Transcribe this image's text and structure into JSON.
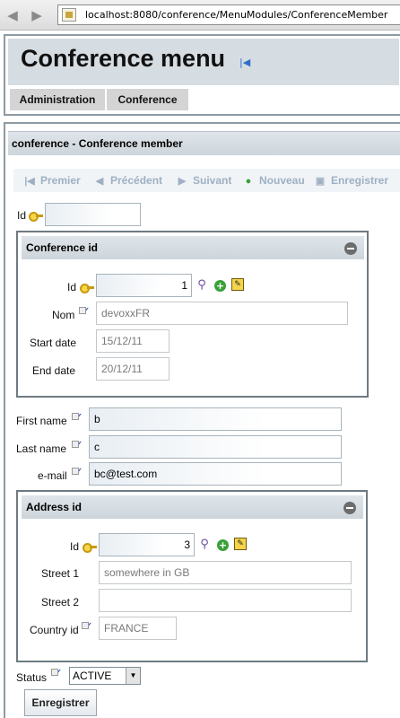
{
  "browser": {
    "url": "localhost:8080/conference/MenuModules/ConferenceMember"
  },
  "header": {
    "title": "Conference menu"
  },
  "menu": {
    "items": [
      "Administration",
      "Conference"
    ]
  },
  "section": {
    "title": "conference - Conference member"
  },
  "toolbar": {
    "first": "Premier",
    "previous": "Précédent",
    "next": "Suivant",
    "new": "Nouveau",
    "save": "Enregistrer"
  },
  "form": {
    "id": {
      "label": "Id",
      "value": ""
    },
    "conference": {
      "legend": "Conference id",
      "id_label": "Id",
      "id_value": "1",
      "nom_label": "Nom",
      "nom_value": "devoxxFR",
      "start_label": "Start date",
      "start_value": "15/12/11",
      "end_label": "End date",
      "end_value": "20/12/11"
    },
    "first_name": {
      "label": "First name",
      "value": "b"
    },
    "last_name": {
      "label": "Last name",
      "value": "c"
    },
    "email": {
      "label": "e-mail",
      "value": "bc@test.com"
    },
    "address": {
      "legend": "Address id",
      "id_label": "Id",
      "id_value": "3",
      "street1_label": "Street 1",
      "street1_value": "somewhere in GB",
      "street2_label": "Street 2",
      "street2_value": "",
      "country_label": "Country id",
      "country_value": "FRANCE"
    },
    "status": {
      "label": "Status",
      "value": "ACTIVE"
    },
    "submit_label": "Enregistrer"
  }
}
